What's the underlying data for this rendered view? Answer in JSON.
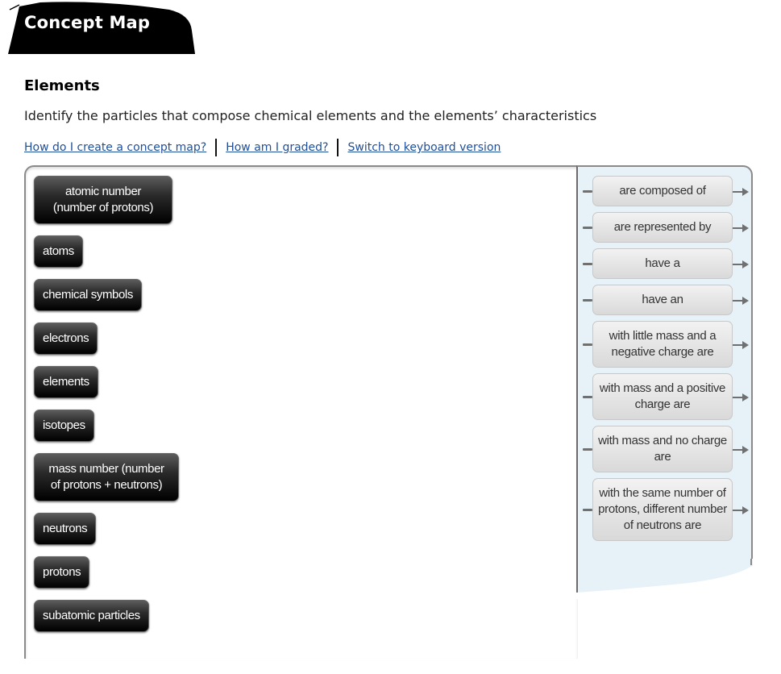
{
  "banner": {
    "title": "Concept Map"
  },
  "page": {
    "heading": "Elements",
    "description": "Identify the particles that compose chemical elements and the elements’ characteristics"
  },
  "help_links": [
    {
      "label": "How do I create a concept map?"
    },
    {
      "label": "How am I graded?"
    },
    {
      "label": "Switch to keyboard version"
    }
  ],
  "terms": [
    {
      "label": "atomic number (number of protons)"
    },
    {
      "label": "atoms"
    },
    {
      "label": "chemical symbols"
    },
    {
      "label": "electrons"
    },
    {
      "label": "elements"
    },
    {
      "label": "isotopes"
    },
    {
      "label": "mass number (number of protons + neutrons)"
    },
    {
      "label": "neutrons"
    },
    {
      "label": "protons"
    },
    {
      "label": "subatomic particles"
    }
  ],
  "linkers": [
    {
      "label": "are composed of"
    },
    {
      "label": "are represented by"
    },
    {
      "label": "have a"
    },
    {
      "label": "have an"
    },
    {
      "label": "with little mass and a negative charge are"
    },
    {
      "label": "with mass and a positive charge are"
    },
    {
      "label": "with mass and no charge are"
    },
    {
      "label": "with the same number of protons, different number of neutrons are"
    }
  ],
  "colors": {
    "link": "#1f4f9a",
    "linker_panel_bg": "#e6f1f8",
    "term_bg": "#000000"
  }
}
